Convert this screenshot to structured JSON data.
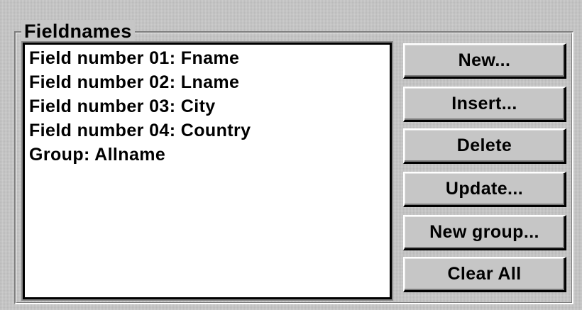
{
  "group": {
    "title": "Fieldnames"
  },
  "list": {
    "items": [
      "Field number 01: Fname",
      "Field number 02: Lname",
      "Field number 03: City",
      "Field number 04: Country",
      "Group: Allname"
    ]
  },
  "buttons": {
    "new": "New...",
    "insert": "Insert...",
    "delete": "Delete",
    "update": "Update...",
    "new_group": "New group...",
    "clear_all": "Clear All"
  },
  "colors": {
    "dialog_background": "#c6c6c6",
    "list_background": "#ffffff",
    "text": "#000000"
  }
}
